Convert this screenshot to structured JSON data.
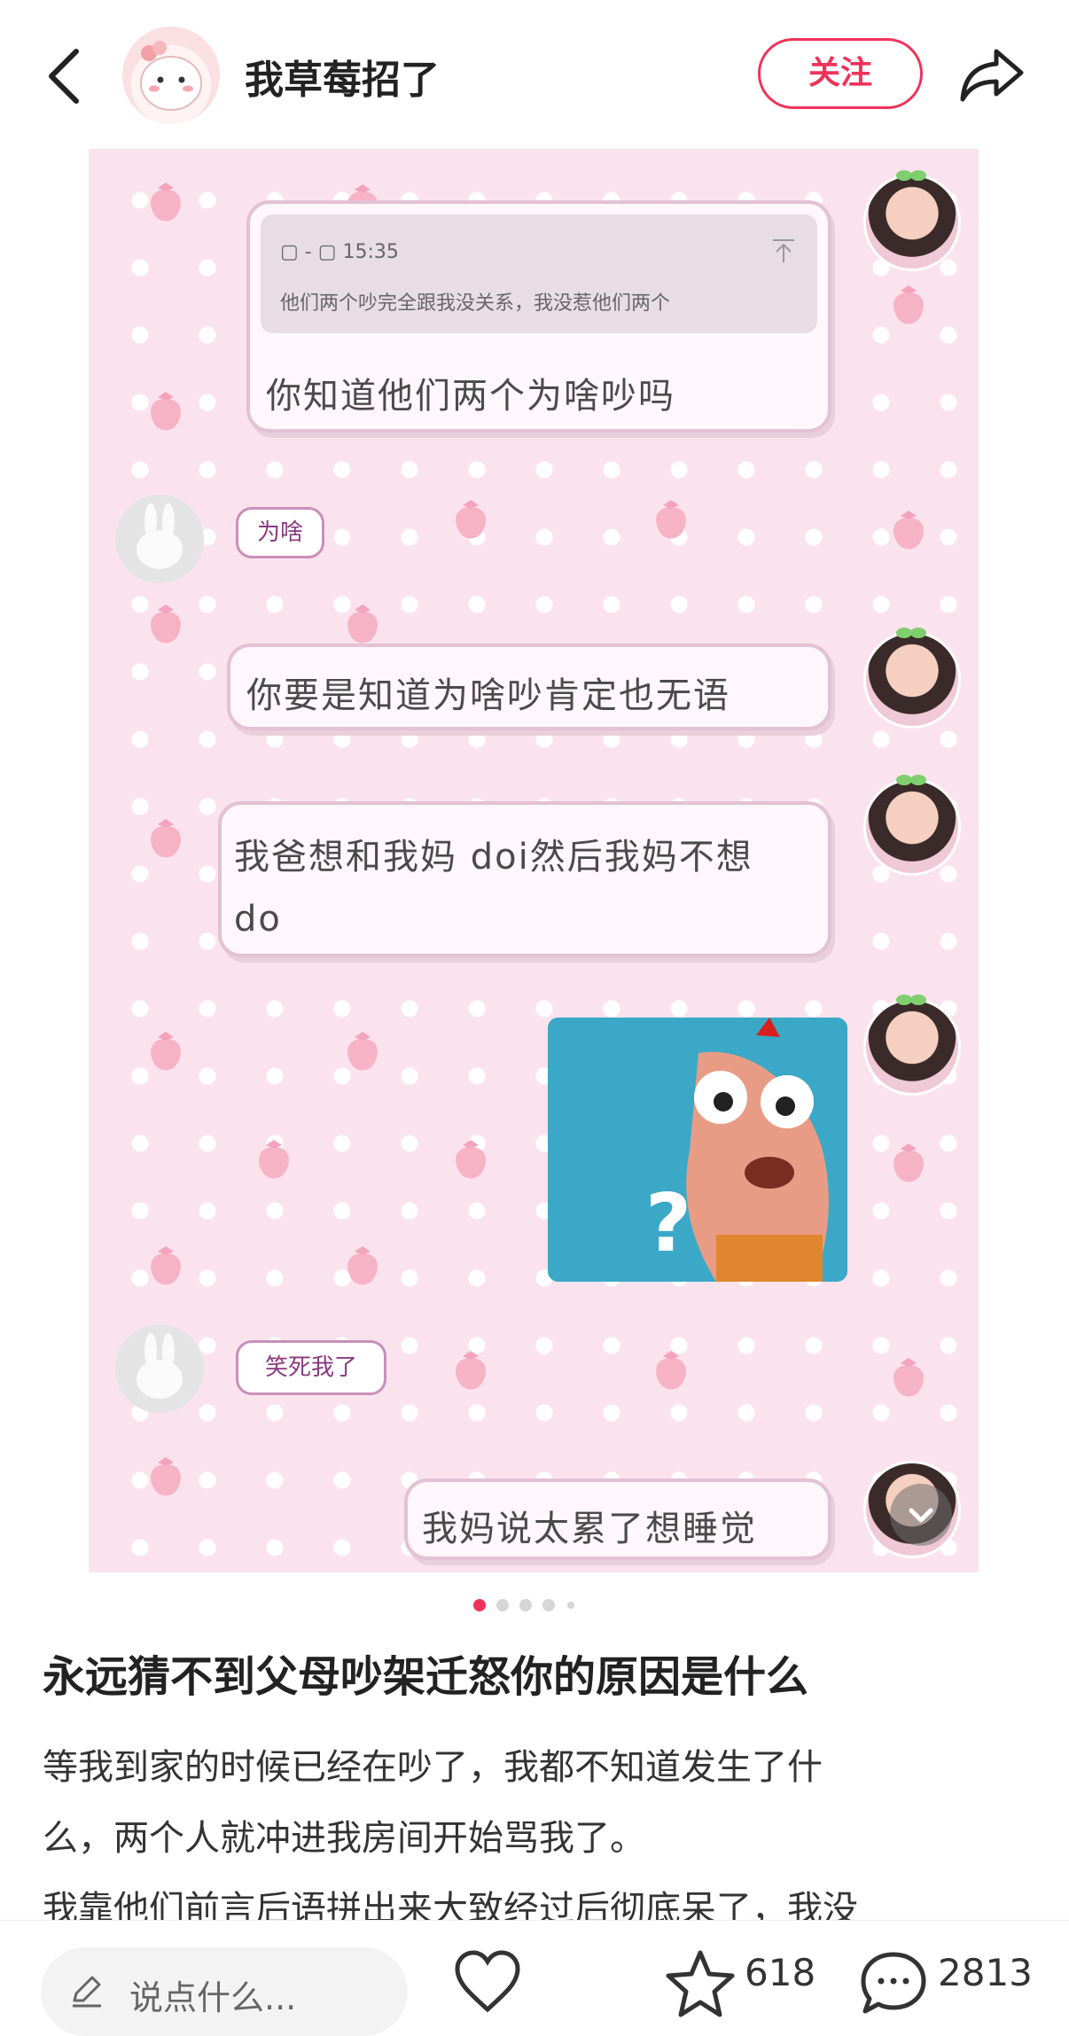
{
  "header": {
    "author_name": "我草莓招了",
    "follow_label": "关注"
  },
  "chat": {
    "quote_time": "15:35",
    "quote_text": "他们两个吵完全跟我没关系，我没惹他们两个",
    "messages": [
      "你知道他们两个为啥吵吗",
      "为啥",
      "你要是知道为啥吵肯定也无语",
      "我爸想和我妈 doi然后我妈不想",
      "do",
      "笑死我了",
      "我妈说太累了想睡觉"
    ],
    "image_glyph": "?"
  },
  "carousel": {
    "total": 5,
    "active": 1
  },
  "post": {
    "title": "永远猜不到父母吵架迁怒你的原因是什么",
    "body_line1": "等我到家的时候已经在吵了，我都不知道发生了什",
    "body_line2": "么，两个人就冲进我房间开始骂我了。",
    "body_line3": "我靠他们前言后语拼出来大致经过后彻底呆了，我没"
  },
  "bottom_bar": {
    "comment_placeholder": "说点什么...",
    "star_count": "618",
    "comment_count": "2813"
  },
  "colors": {
    "accent": "#f0325a",
    "chat_background": "#fbe3ee"
  }
}
